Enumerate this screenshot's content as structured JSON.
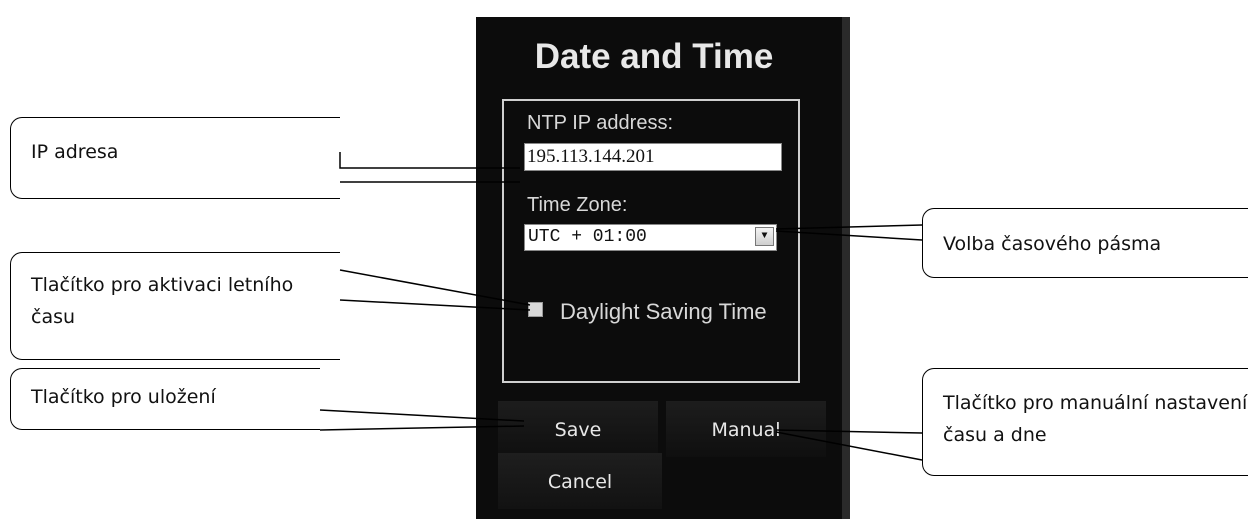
{
  "dialog": {
    "title": "Date and Time",
    "ntp_label": "NTP IP address:",
    "ntp_value": "195.113.144.201",
    "timezone_label": "Time Zone:",
    "timezone_value": "UTC + 01:00",
    "dst_label": "Daylight Saving Time",
    "dst_checked": false,
    "buttons": {
      "save": "Save",
      "manual": "Manual",
      "cancel": "Cancel"
    }
  },
  "callouts": {
    "ip": "IP adresa",
    "dst": "Tlačítko pro aktivaci letního času",
    "save": "Tlačítko pro uložení",
    "timezone": "Volba časového pásma",
    "manual": "Tlačítko pro manuální nastavení času a dne"
  },
  "colors": {
    "panel_bg": "#0c0c0c",
    "panel_text": "#e8e8e8",
    "callout_border": "#000000"
  }
}
